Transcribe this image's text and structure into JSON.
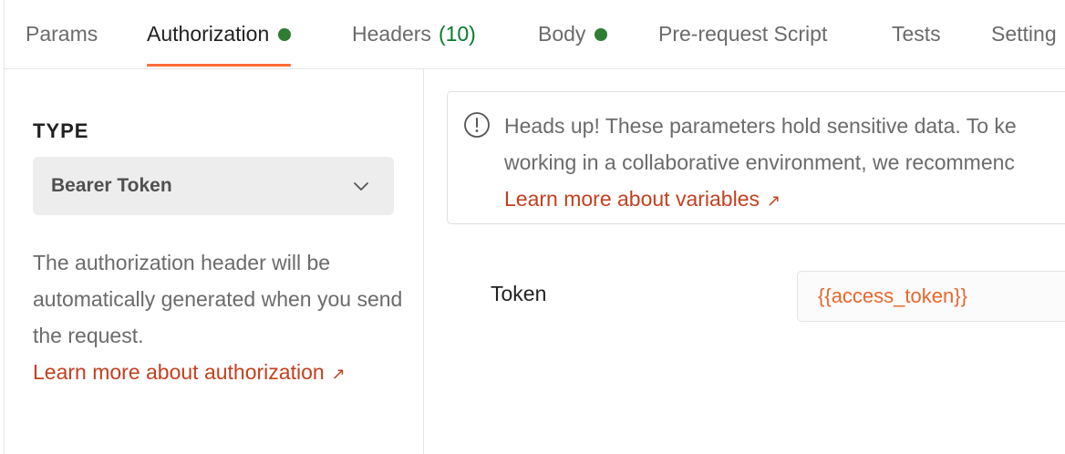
{
  "tabs": [
    {
      "label": "Params"
    },
    {
      "label": "Authorization",
      "indicator": "green-dot",
      "active": true
    },
    {
      "label": "Headers",
      "count": "(10)"
    },
    {
      "label": "Body",
      "indicator": "green-dot"
    },
    {
      "label": "Pre-request Script"
    },
    {
      "label": "Tests"
    },
    {
      "label": "Setting"
    }
  ],
  "auth": {
    "type_label": "TYPE",
    "type_selected": "Bearer Token",
    "description": "The authorization header will be automatically generated when you send the request.",
    "learn_more_link": "Learn more about authorization",
    "link_icon": "arrow-up-right-icon"
  },
  "notice": {
    "icon": "info-icon",
    "line1": "Heads up! These parameters hold sensitive data. To ke",
    "line2": "working in a collaborative environment, we recommenc",
    "link": "Learn more about variables"
  },
  "token": {
    "label": "Token",
    "value": "{{access_token}}"
  },
  "colors": {
    "accent": "#ff6c37",
    "link": "#c4401f",
    "status_dot": "#2e7d32",
    "count": "#0b7a2e",
    "variable": "#e8672d"
  }
}
